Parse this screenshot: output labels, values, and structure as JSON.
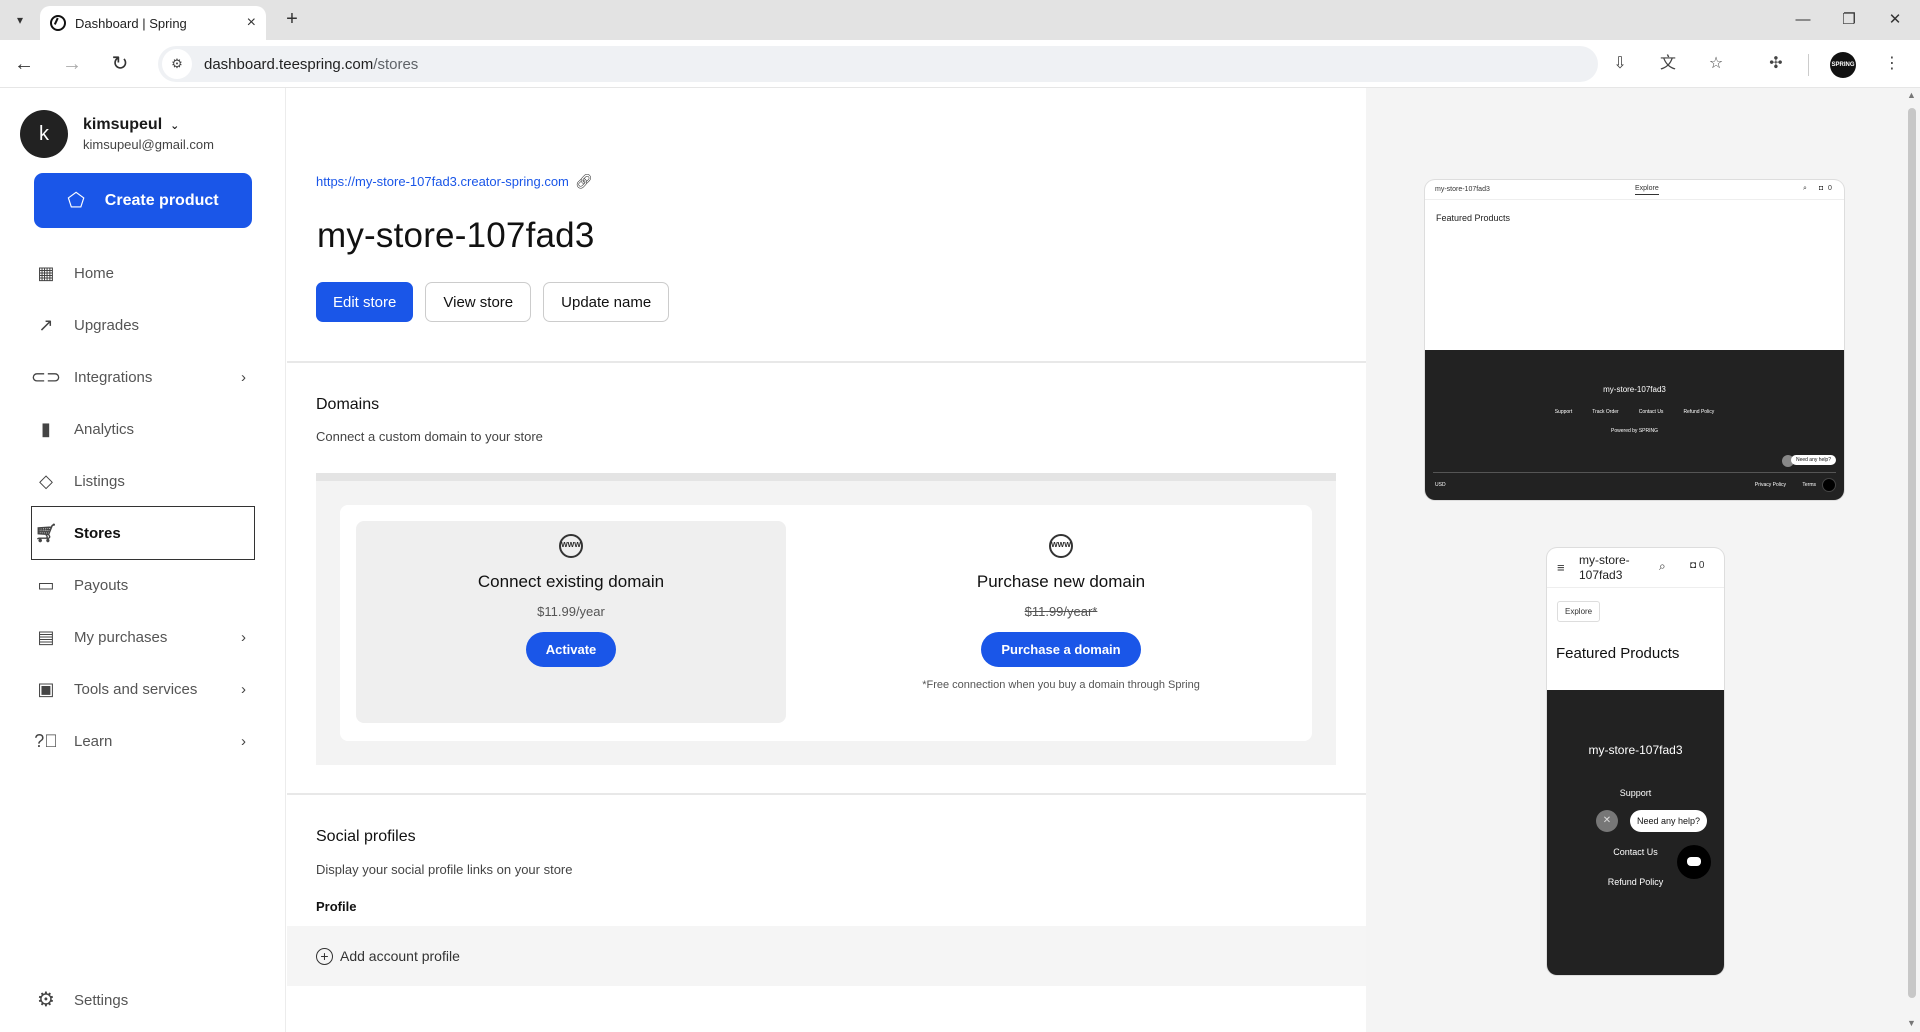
{
  "browser": {
    "tab_title": "Dashboard | Spring",
    "url_host": "dashboard.teespring.com",
    "url_path": "/stores",
    "profile_label": "SPRING"
  },
  "sidebar": {
    "user_initial": "k",
    "username": "kimsupeul",
    "email": "kimsupeul@gmail.com",
    "create_label": "Create product",
    "items": [
      {
        "label": "Home"
      },
      {
        "label": "Upgrades"
      },
      {
        "label": "Integrations"
      },
      {
        "label": "Analytics"
      },
      {
        "label": "Listings"
      },
      {
        "label": "Stores"
      },
      {
        "label": "Payouts"
      },
      {
        "label": "My purchases"
      },
      {
        "label": "Tools and services"
      },
      {
        "label": "Learn"
      }
    ],
    "settings_label": "Settings"
  },
  "main": {
    "store_url": "https://my-store-107fad3.creator-spring.com",
    "store_name": "my-store-107fad3",
    "edit_label": "Edit store",
    "view_label": "View store",
    "update_label": "Update name",
    "domains": {
      "title": "Domains",
      "subtitle": "Connect a custom domain to your store",
      "connect": {
        "title": "Connect existing domain",
        "price": "$11.99/year",
        "button": "Activate"
      },
      "purchase": {
        "title": "Purchase new domain",
        "price": "$11.99/year*",
        "button": "Purchase a domain",
        "note": "*Free connection when you buy a domain through Spring"
      },
      "icon_text": "WWW"
    },
    "social": {
      "title": "Social profiles",
      "subtitle": "Display your social profile links on your store",
      "profile_label": "Profile",
      "add_label": "Add account profile"
    }
  },
  "preview": {
    "desktop": {
      "store_name": "my-store-107fad3",
      "explore": "Explore",
      "featured": "Featured Products",
      "cart_count": "0",
      "links": [
        "Support",
        "Track Order",
        "Contact Us",
        "Refund Policy"
      ],
      "powered": "Powered by",
      "powered_brand": "SPRING",
      "help": "Need any help?",
      "currency": "USD",
      "privacy": "Privacy Policy",
      "terms": "Terms"
    },
    "mobile": {
      "store_name": "my-store-107fad3",
      "cart_count": "0",
      "explore": "Explore",
      "featured": "Featured Products",
      "support": "Support",
      "contact": "Contact Us",
      "refund": "Refund Policy",
      "help": "Need any help?"
    }
  }
}
